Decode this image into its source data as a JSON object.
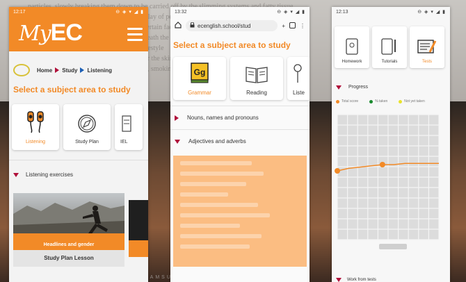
{
  "background": {
    "doc_lines": [
      "particles, slowly breaking them down to be carried off by the slimming systems and fatty tissue",
      "the condition results from a complex interplay of personal history and factors",
      "ssue personal skin are not fully clear, but certain factors increase risk",
      "ur skin and the way the body stores fat beneath the surface layers",
      "ns genetic predisposition, hormones and lifestyle",
      "ts blood flow and circulation changes under the skin",
      "ulbs, black tea, weight gain and loss cycles, smoking",
      "n, harder to treat skin, sitting or standing",
      "ng a tattoo, massage and topical creams"
    ],
    "laptop_brand": "SAMSUNG",
    "side_text": "clo..."
  },
  "phone1": {
    "status_time": "12:17",
    "status_icons": "⊖ ◈ ▾ ◢ ▮",
    "logo_my": "My",
    "logo_ec": "EC",
    "breadcrumb": {
      "home": "Home",
      "study": "Study",
      "listening": "Listening"
    },
    "section_title": "Select a subject area to study",
    "cards": [
      {
        "label": "Listening",
        "icon": "headphones-icon",
        "active": true
      },
      {
        "label": "Study Plan",
        "icon": "compass-icon",
        "active": false
      },
      {
        "label": "IEL",
        "icon": "scroll-icon",
        "active": false
      }
    ],
    "exercises_label": "Listening exercises",
    "video_caption": "Headlines and gender",
    "lesson_label": "Study Plan Lesson",
    "colors": {
      "accent": "#f28a27",
      "crumb_marker": "#b0103a"
    }
  },
  "phone2": {
    "status_time": "13:32",
    "status_icons": "⊖ ◈ ▾ ◢ ▮",
    "url": "ecenglish.school/stud",
    "section_title": "Select a subject area to study",
    "cards": [
      {
        "label": "Grammar",
        "icon": "grammar-book-icon",
        "active": true
      },
      {
        "label": "Reading",
        "icon": "open-book-icon",
        "active": false
      },
      {
        "label": "Liste",
        "icon": "headphones-icon",
        "active": false
      }
    ],
    "accordion": [
      {
        "label": "Nouns, names and pronouns",
        "expanded": false
      },
      {
        "label": "Adjectives and adverbs",
        "expanded": true
      }
    ]
  },
  "phone3": {
    "status_time": "12:13",
    "status_icons": "⊖ ◈ ▾ ◢ ▮",
    "tiles": [
      {
        "label": "Homework",
        "icon": "tablet-icon",
        "active": false
      },
      {
        "label": "Tutorials",
        "icon": "tablet-pencil-icon",
        "active": false
      },
      {
        "label": "Tests",
        "icon": "test-sheet-icon",
        "active": true
      }
    ],
    "progress_label": "Progress",
    "legend": [
      {
        "label": "Total score",
        "color": "#f28a27"
      },
      {
        "label": "% taken",
        "color": "#1a8a2e"
      },
      {
        "label": "Not yet taken",
        "color": "#e8e22b"
      }
    ],
    "bottom_label": "Work from tests"
  },
  "chart_data": {
    "type": "line",
    "title": "",
    "xlabel": "",
    "ylabel": "",
    "x": [
      1,
      2,
      3,
      4,
      5,
      6,
      7,
      8,
      9,
      10
    ],
    "series": [
      {
        "values": [
          55,
          57,
          58,
          59,
          60,
          60,
          61,
          61,
          61,
          61
        ],
        "color": "#f28a27"
      }
    ],
    "ylim": [
      0,
      100
    ],
    "grid": true
  }
}
